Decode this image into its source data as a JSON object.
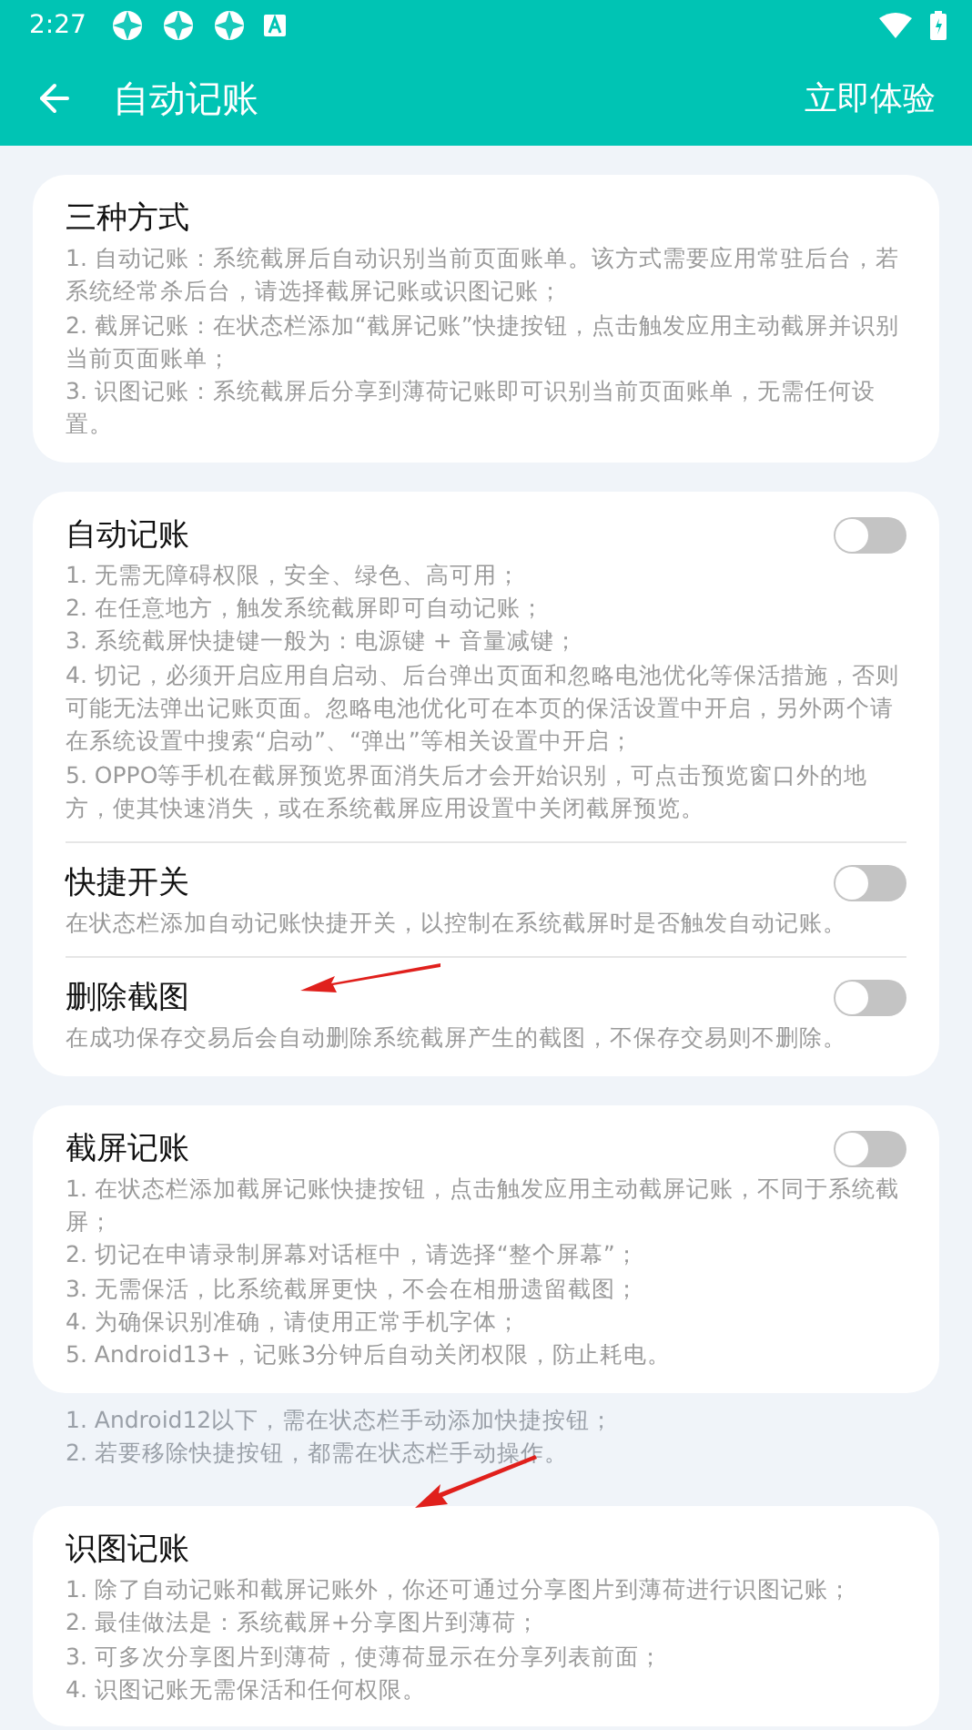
{
  "status_bar": {
    "time": "2:27"
  },
  "app_bar": {
    "title": "自动记账",
    "action": "立即体验"
  },
  "cards": [
    {
      "rows": [
        {
          "title": "三种方式",
          "marked": false,
          "lines": [
            "1. 自动记账：系统截屏后自动识别当前页面账单。该方式需要应用常驻后台，若系统经常杀后台，请选择截屏记账或识图记账；",
            "2. 截屏记账：在状态栏添加“截屏记账”快捷按钮，点击触发应用主动截屏并识别当前页面账单；",
            "3. 识图记账：系统截屏后分享到薄荷记账即可识别当前页面账单，无需任何设置。"
          ]
        }
      ]
    },
    {
      "rows": [
        {
          "title": "自动记账",
          "marked": false,
          "toggle": {
            "on": false
          },
          "lines": [
            "1. 无需无障碍权限，安全、绿色、高可用；",
            "2. 在任意地方，触发系统截屏即可自动记账；",
            "3. 系统截屏快捷键一般为：电源键 + 音量减键；",
            "4. 切记，必须开启应用自启动、后台弹出页面和忽略电池优化等保活措施，否则可能无法弹出记账页面。忽略电池优化可在本页的保活设置中开启，另外两个请在系统设置中搜索“启动”、“弹出”等相关设置中开启；",
            "5. OPPO等手机在截屏预览界面消失后才会开始识别，可点击预览窗口外的地方，使其快速消失，或在系统截屏应用设置中关闭截屏预览。"
          ]
        },
        {
          "title": "快捷开关",
          "marked": false,
          "toggle": {
            "on": false
          },
          "lines": [
            "在状态栏添加自动记账快捷开关，以控制在系统截屏时是否触发自动记账。"
          ]
        },
        {
          "title": "删除截图",
          "marked": true,
          "toggle": {
            "on": false
          },
          "lines": [
            "在成功保存交易后会自动删除系统截屏产生的截图，不保存交易则不删除。"
          ]
        }
      ]
    },
    {
      "rows": [
        {
          "title": "截屏记账",
          "marked": false,
          "toggle": {
            "on": false
          },
          "lines": [
            "1. 在状态栏添加截屏记账快捷按钮，点击触发应用主动截屏记账，不同于系统截屏；",
            "2. 切记在申请录制屏幕对话框中，请选择“整个屏幕”；",
            "3. 无需保活，比系统截屏更快，不会在相册遗留截图；",
            "4. 为确保识别准确，请使用正常手机字体；",
            "5. Android13+，记账3分钟后自动关闭权限，防止耗电。"
          ]
        }
      ],
      "notes": [
        "1. Android12以下，需在状态栏手动添加快捷按钮；",
        "2. 若要移除快捷按钮，都需在状态栏手动操作。"
      ]
    },
    {
      "rows": [
        {
          "title": "识图记账",
          "marked": true,
          "lines": [
            "1. 除了自动记账和截屏记账外，你还可通过分享图片到薄荷进行识图记账；",
            "2. 最佳做法是：系统截屏+分享图片到薄荷；",
            "3. 可多次分享图片到薄荷，使薄荷显示在分享列表前面；",
            "4. 识图记账无需保活和任何权限。"
          ]
        }
      ]
    }
  ]
}
